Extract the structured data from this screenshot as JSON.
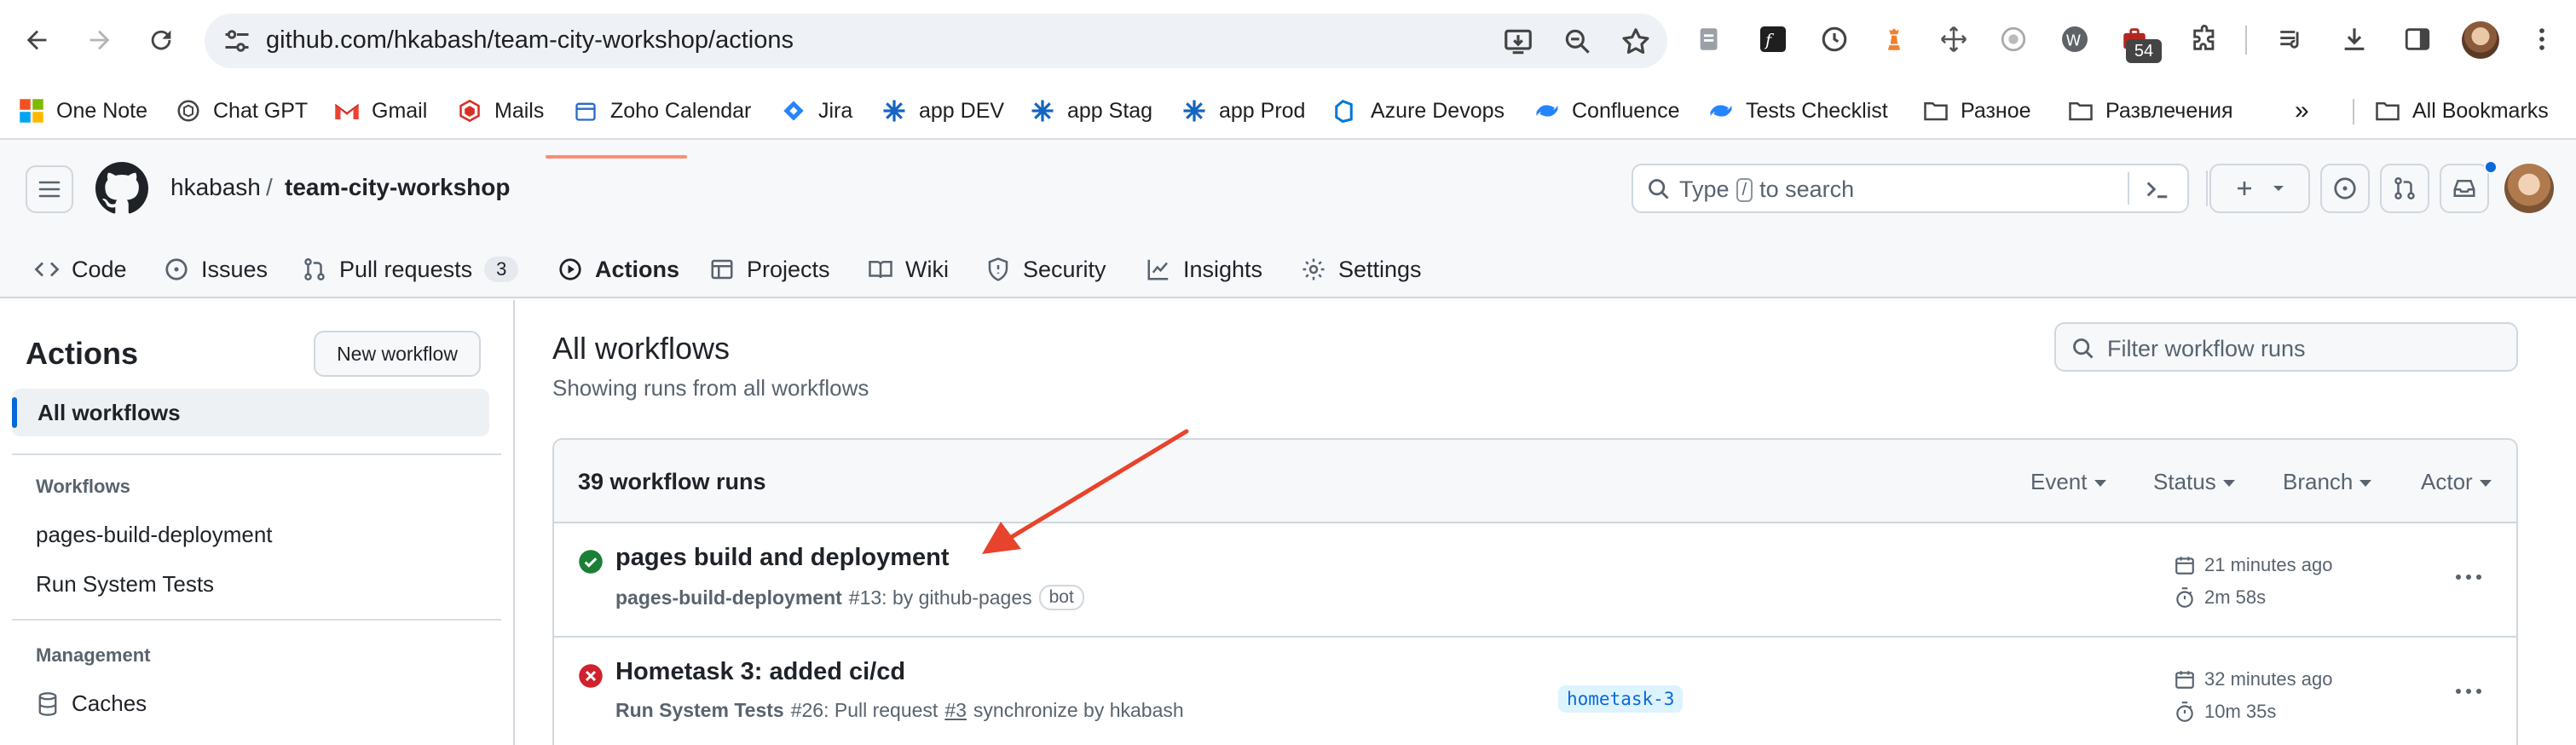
{
  "browser": {
    "url": "github.com/hkabash/team-city-workshop/actions",
    "extensions_badge": "54",
    "bookmarks": [
      {
        "label": "One Note",
        "icon": "microsoft-icon"
      },
      {
        "label": "Chat GPT",
        "icon": "chatgpt-icon"
      },
      {
        "label": "Gmail",
        "icon": "gmail-icon"
      },
      {
        "label": "Mails",
        "icon": "mail-icon"
      },
      {
        "label": "Zoho Calendar",
        "icon": "calendar-icon"
      },
      {
        "label": "Jira",
        "icon": "jira-icon"
      },
      {
        "label": "app DEV",
        "icon": "app-icon"
      },
      {
        "label": "app Stag",
        "icon": "app-icon"
      },
      {
        "label": "app Prod",
        "icon": "app-icon"
      },
      {
        "label": "Azure Devops",
        "icon": "azure-devops-icon"
      },
      {
        "label": "Confluence",
        "icon": "confluence-icon"
      },
      {
        "label": "Tests Checklist",
        "icon": "confluence-icon"
      },
      {
        "label": "Разное",
        "icon": "folder-icon"
      },
      {
        "label": "Развлечения",
        "icon": "folder-icon"
      }
    ],
    "all_bookmarks": "All Bookmarks",
    "overflow": "»"
  },
  "header": {
    "owner": "hkabash",
    "separator": "/",
    "repo": "team-city-workshop",
    "search_prefix": "Type",
    "search_key": "/",
    "search_suffix": "to search"
  },
  "tabs": [
    {
      "label": "Code",
      "icon": "code-icon"
    },
    {
      "label": "Issues",
      "icon": "issue-icon"
    },
    {
      "label": "Pull requests",
      "icon": "pull-request-icon",
      "count": "3"
    },
    {
      "label": "Actions",
      "icon": "play-icon",
      "active": true
    },
    {
      "label": "Projects",
      "icon": "table-icon"
    },
    {
      "label": "Wiki",
      "icon": "book-icon"
    },
    {
      "label": "Security",
      "icon": "shield-icon"
    },
    {
      "label": "Insights",
      "icon": "graph-icon"
    },
    {
      "label": "Settings",
      "icon": "gear-icon"
    }
  ],
  "sidebar": {
    "title": "Actions",
    "new_workflow": "New workflow",
    "all_workflows": "All workflows",
    "workflows_heading": "Workflows",
    "workflows": [
      "pages-build-deployment",
      "Run System Tests"
    ],
    "management_heading": "Management",
    "management": [
      "Caches"
    ]
  },
  "main": {
    "title": "All workflows",
    "subtitle": "Showing runs from all workflows",
    "filter_placeholder": "Filter workflow runs",
    "runs_count": "39 workflow runs",
    "filters": [
      "Event",
      "Status",
      "Branch",
      "Actor"
    ],
    "runs": [
      {
        "status": "success",
        "title": "pages build and deployment",
        "workflow": "pages-build-deployment",
        "detail": "#13: by github-pages",
        "badge": "bot",
        "branch": "",
        "time": "21 minutes ago",
        "duration": "2m 58s"
      },
      {
        "status": "failure",
        "title": "Hometask 3: added ci/cd",
        "workflow": "Run System Tests",
        "detail_pre": "#26: Pull request",
        "pr": "#3",
        "detail_post": "synchronize by hkabash",
        "branch": "hometask-3",
        "time": "32 minutes ago",
        "duration": "10m 35s"
      }
    ]
  },
  "colors": {
    "accent_blue": "#0969da",
    "success_green": "#1a7f37",
    "failure_red": "#cf222e",
    "tab_underline": "#fd8c73",
    "annotation_arrow": "#e8432c"
  }
}
